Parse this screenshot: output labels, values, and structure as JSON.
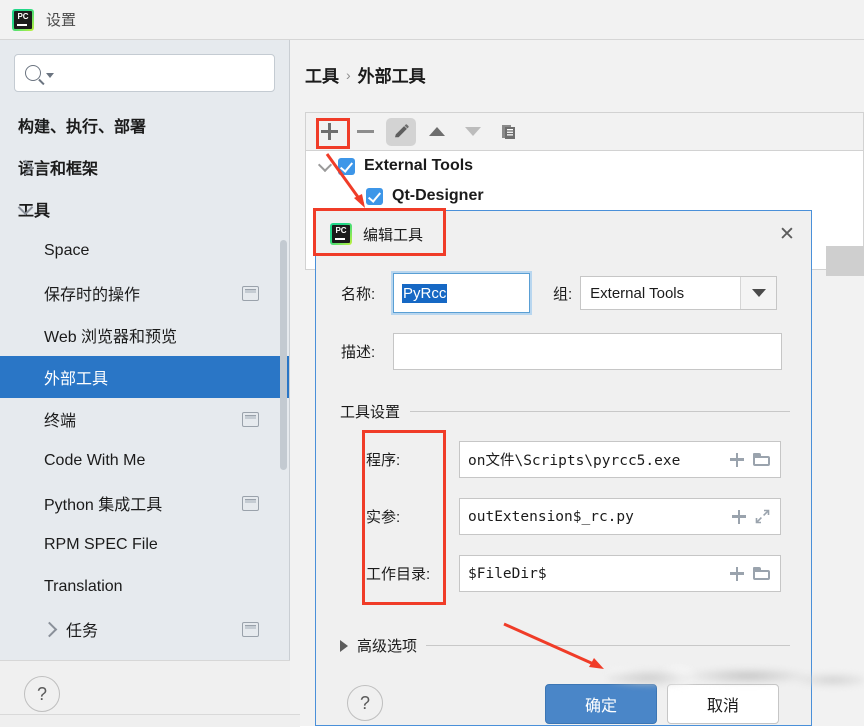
{
  "window": {
    "title": "设置",
    "app_icon": "pycharm-icon"
  },
  "sidebar": {
    "search": {
      "placeholder": "",
      "value": "",
      "icon": "search-icon"
    },
    "items": [
      {
        "label": "构建、执行、部署",
        "level": 0,
        "bold": true,
        "expander": "none",
        "badge": false,
        "selected": false
      },
      {
        "label": "语言和框架",
        "level": 0,
        "bold": true,
        "expander": "right",
        "badge": false,
        "selected": false
      },
      {
        "label": "工具",
        "level": 0,
        "bold": true,
        "expander": "down",
        "badge": false,
        "selected": false
      },
      {
        "label": "Space",
        "level": 1,
        "bold": false,
        "expander": "none",
        "badge": false,
        "selected": false
      },
      {
        "label": "保存时的操作",
        "level": 1,
        "bold": false,
        "expander": "none",
        "badge": true,
        "selected": false
      },
      {
        "label": "Web 浏览器和预览",
        "level": 1,
        "bold": false,
        "expander": "none",
        "badge": false,
        "selected": false
      },
      {
        "label": "外部工具",
        "level": 1,
        "bold": false,
        "expander": "none",
        "badge": false,
        "selected": true
      },
      {
        "label": "终端",
        "level": 1,
        "bold": false,
        "expander": "none",
        "badge": true,
        "selected": false
      },
      {
        "label": "Code With Me",
        "level": 1,
        "bold": false,
        "expander": "none",
        "badge": false,
        "selected": false
      },
      {
        "label": "Python 集成工具",
        "level": 1,
        "bold": false,
        "expander": "none",
        "badge": true,
        "selected": false
      },
      {
        "label": "RPM SPEC File",
        "level": 1,
        "bold": false,
        "expander": "none",
        "badge": false,
        "selected": false
      },
      {
        "label": "Translation",
        "level": 1,
        "bold": false,
        "expander": "none",
        "badge": false,
        "selected": false
      },
      {
        "label": "任务",
        "level": 1,
        "bold": false,
        "expander": "right",
        "badge": true,
        "selected": false
      }
    ],
    "help_label": "?"
  },
  "main": {
    "breadcrumb": {
      "root": "工具",
      "separator": "›",
      "leaf": "外部工具"
    },
    "toolbar": [
      {
        "name": "add-button",
        "icon": "plus-icon"
      },
      {
        "name": "remove-button",
        "icon": "minus-icon"
      },
      {
        "name": "edit-button",
        "icon": "pencil-icon"
      },
      {
        "name": "move-up-button",
        "icon": "triangle-up-icon"
      },
      {
        "name": "move-down-button",
        "icon": "triangle-down-icon"
      },
      {
        "name": "copy-button",
        "icon": "copy-icon"
      }
    ],
    "tree": [
      {
        "label": "External Tools",
        "level": 0,
        "checked": true
      },
      {
        "label": "Qt-Designer",
        "level": 1,
        "checked": true
      }
    ]
  },
  "dialog": {
    "title": "编辑工具",
    "icon": "pycharm-icon",
    "close_label": "✕",
    "name_label": "名称:",
    "name_value": "PyRcc",
    "group_label": "组:",
    "group_value": "External Tools",
    "description_label": "描述:",
    "description_value": "",
    "section_tool_settings": "工具设置",
    "fields": [
      {
        "label": "程序:",
        "value": "on文件\\Scripts\\pyrcc5.exe",
        "icons": [
          "plus-icon",
          "folder-icon"
        ]
      },
      {
        "label": "实参:",
        "value": "outExtension$_rc.py",
        "icons": [
          "plus-icon",
          "expand-icon"
        ]
      },
      {
        "label": "工作目录:",
        "value": "$FileDir$",
        "icons": [
          "plus-icon",
          "folder-icon"
        ]
      }
    ],
    "advanced_label": "高级选项",
    "help_label": "?",
    "ok_label": "确定",
    "cancel_label": "取消"
  },
  "colors": {
    "selection_blue": "#2a76c6",
    "text_selection_blue": "#1668c4",
    "primary_button": "#4a86c8",
    "checkbox_blue": "#3d96e8",
    "annotation_red": "#f03c28",
    "dialog_border": "#4a90d9"
  }
}
